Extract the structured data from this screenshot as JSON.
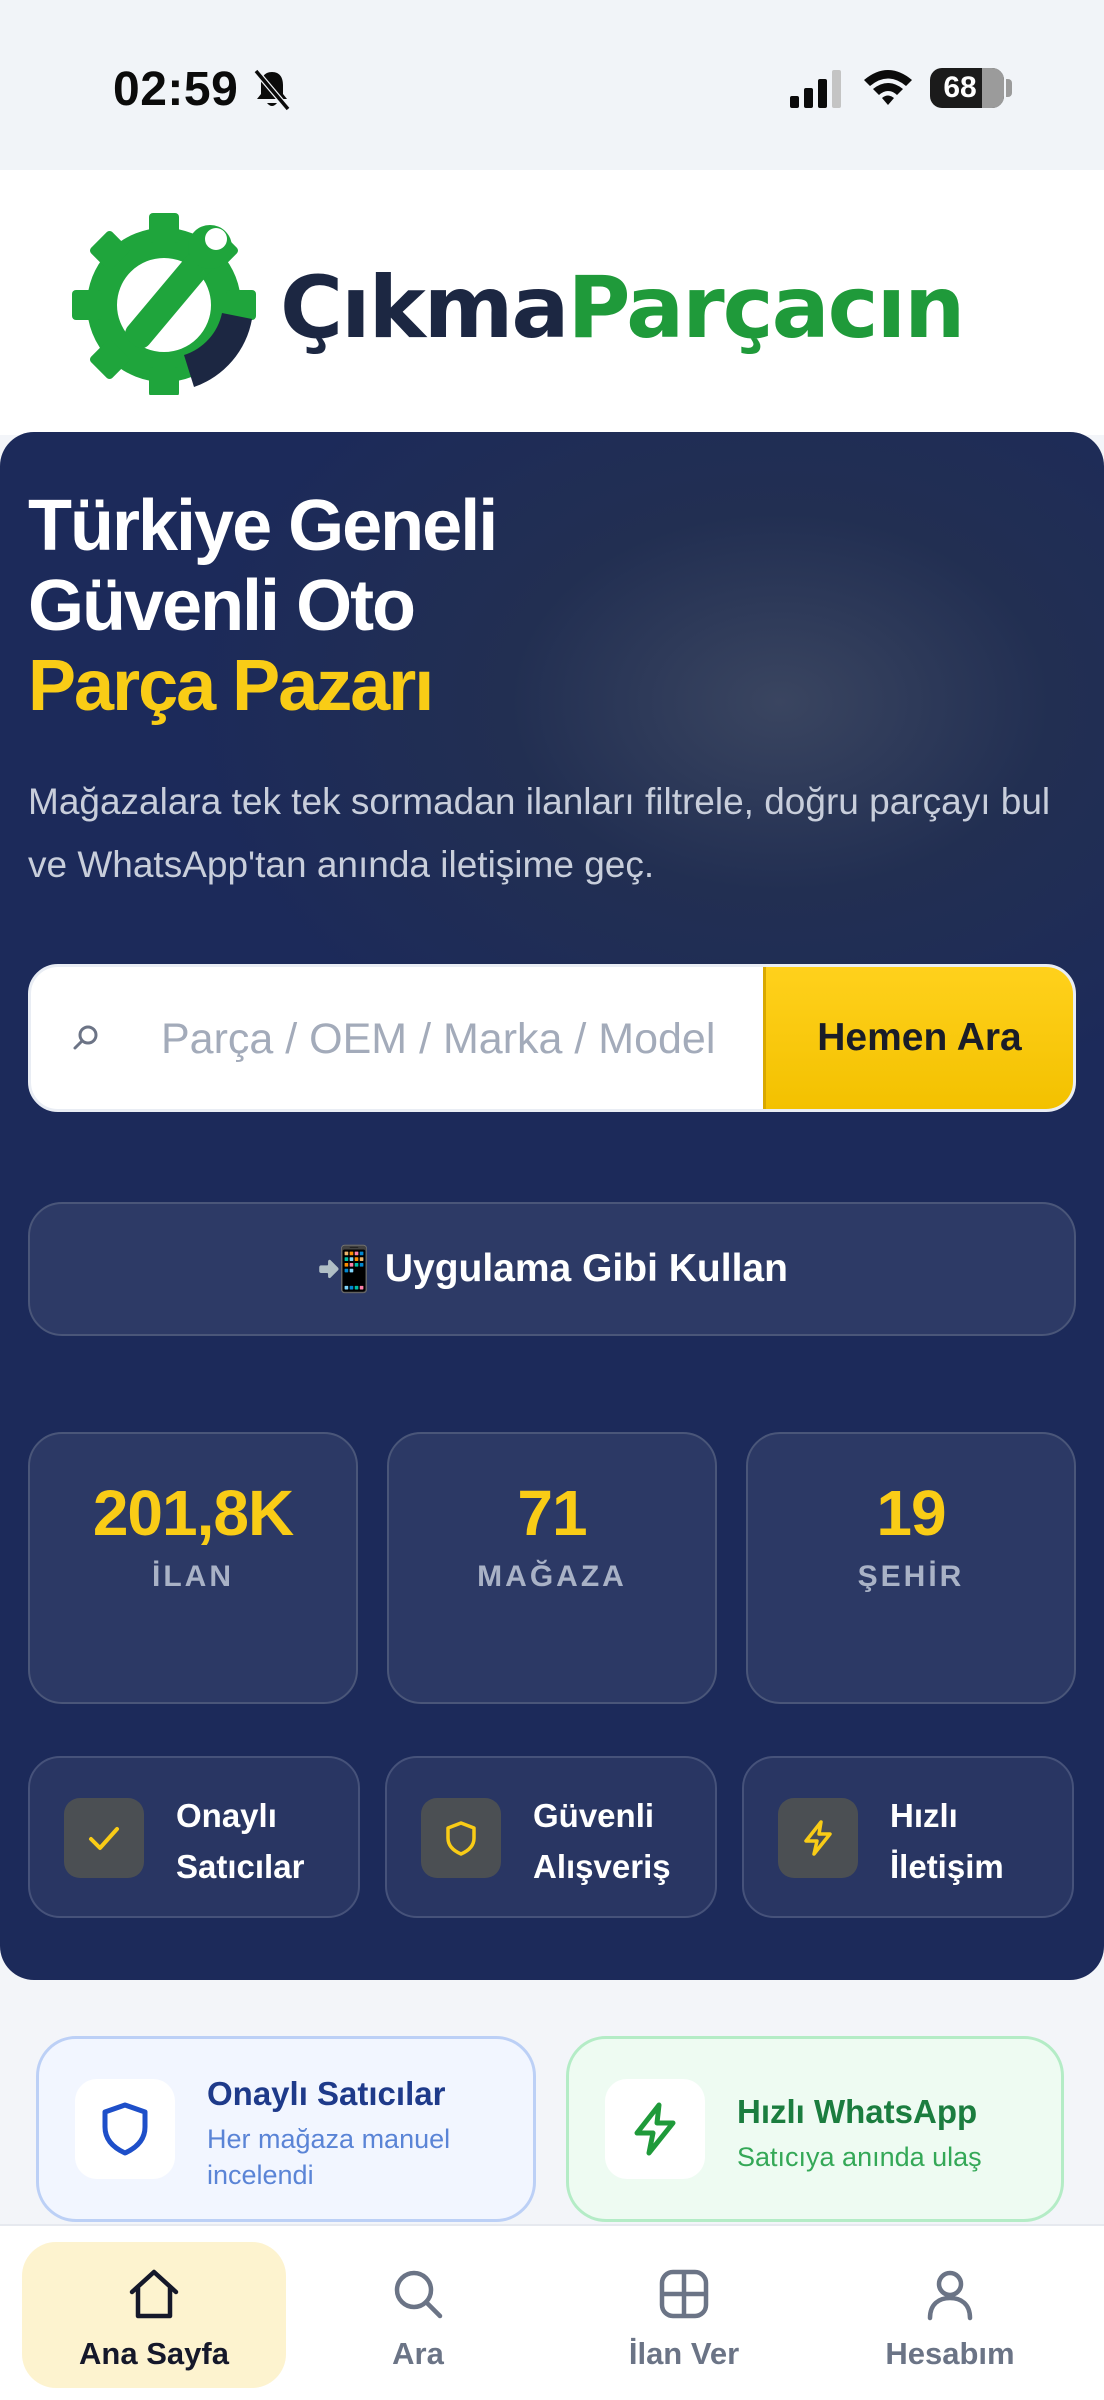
{
  "status_bar": {
    "time": "02:59",
    "battery": "68"
  },
  "logo": {
    "part1": "Çıkma",
    "part2": "Parçacın"
  },
  "hero": {
    "title_line1": "Türkiye Geneli",
    "title_line2": "Güvenli Oto",
    "title_line3": "Parça Pazarı",
    "subtitle": "Mağazalara tek tek sormadan ilanları filtrele, doğru parçayı bul ve WhatsApp'tan anında iletişime geç.",
    "search_placeholder": "Parça / OEM / Marka / Model",
    "search_button": "Hemen Ara",
    "pwa_icon": "📲",
    "pwa_label": "Uygulama Gibi Kullan"
  },
  "stats": [
    {
      "value": "201,8K",
      "label": "İLAN"
    },
    {
      "value": "71",
      "label": "MAĞAZA"
    },
    {
      "value": "19",
      "label": "ŞEHİR"
    }
  ],
  "features": [
    {
      "label": "Onaylı Satıcılar",
      "icon": "check-icon"
    },
    {
      "label": "Güvenli Alışveriş",
      "icon": "shield-icon"
    },
    {
      "label": "Hızlı İletişim",
      "icon": "lightning-icon"
    }
  ],
  "promos": [
    {
      "title": "Onaylı Satıcılar",
      "desc": "Her mağaza manuel incelendi",
      "icon": "shield-icon"
    },
    {
      "title": "Hızlı WhatsApp",
      "desc": "Satıcıya anında ulaş",
      "icon": "lightning-icon"
    }
  ],
  "nav": [
    {
      "label": "Ana Sayfa",
      "icon": "home-icon",
      "active": true
    },
    {
      "label": "Ara",
      "icon": "search-icon",
      "active": false
    },
    {
      "label": "İlan Ver",
      "icon": "grid-icon",
      "active": false
    },
    {
      "label": "Hesabım",
      "icon": "user-icon",
      "active": false
    }
  ],
  "colors": {
    "accent": "#f9cc16",
    "hero_bg": "#1c2a5a",
    "brand_green": "#1f9a3a",
    "brand_dark": "#1c2742"
  }
}
